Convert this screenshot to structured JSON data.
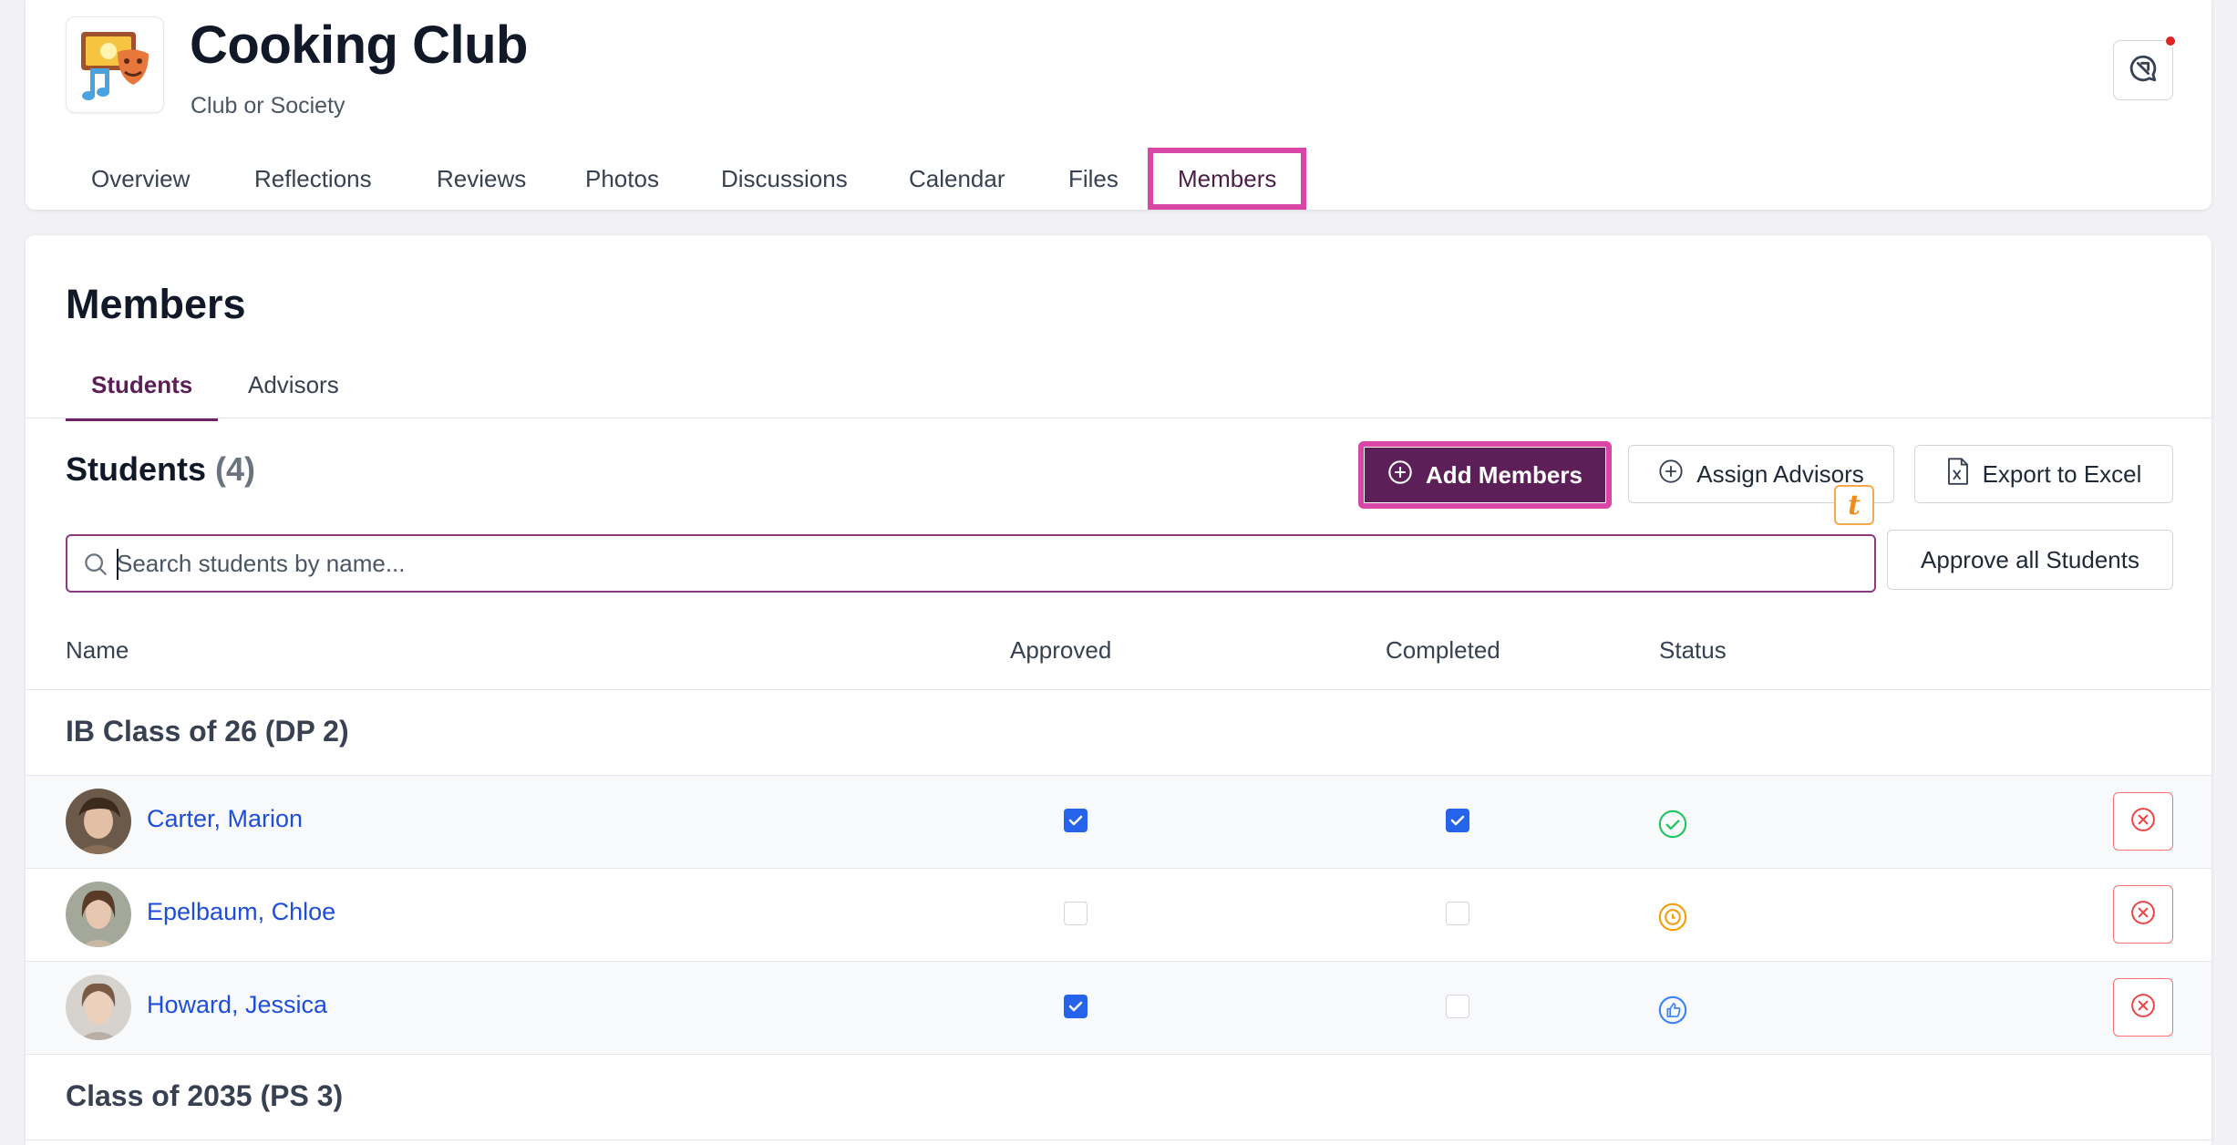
{
  "club": {
    "title": "Cooking Club",
    "subtitle": "Club or Society",
    "logo_icon": "performing-arts-icon"
  },
  "main_nav": {
    "tabs": [
      {
        "label": "Overview"
      },
      {
        "label": "Reflections"
      },
      {
        "label": "Reviews"
      },
      {
        "label": "Photos"
      },
      {
        "label": "Discussions"
      },
      {
        "label": "Calendar"
      },
      {
        "label": "Files"
      },
      {
        "label": "Members",
        "active": true
      }
    ]
  },
  "members": {
    "title": "Members",
    "sub_tabs": [
      {
        "label": "Students",
        "active": true
      },
      {
        "label": "Advisors"
      }
    ],
    "students_heading": "Students",
    "students_count": "(4)",
    "buttons": {
      "add_members": "Add Members",
      "assign_advisors": "Assign Advisors",
      "export_excel": "Export to Excel",
      "approve_all": "Approve all Students"
    },
    "translate_badge": "t",
    "search": {
      "placeholder": "Search students by name...",
      "value": ""
    },
    "columns": {
      "name": "Name",
      "approved": "Approved",
      "completed": "Completed",
      "status": "Status"
    },
    "groups": [
      {
        "label": "IB Class of 26 (DP 2)",
        "students": [
          {
            "name": "Carter, Marion",
            "approved": true,
            "completed": true,
            "status": "completed-check-icon"
          },
          {
            "name": "Epelbaum, Chloe",
            "approved": false,
            "completed": false,
            "status": "pending-clock-icon"
          },
          {
            "name": "Howard, Jessica",
            "approved": true,
            "completed": false,
            "status": "approved-thumbs-up-icon"
          }
        ]
      },
      {
        "label": "Class of 2035 (PS 3)",
        "students": []
      }
    ]
  },
  "colors": {
    "brand": "#5c1f57",
    "highlight": "#d946a8",
    "link": "#1d4ed8",
    "check_blue": "#2563eb",
    "status_green": "#22c55e",
    "status_orange": "#f59e0b",
    "status_blue": "#3b82f6",
    "danger": "#ef4444"
  }
}
